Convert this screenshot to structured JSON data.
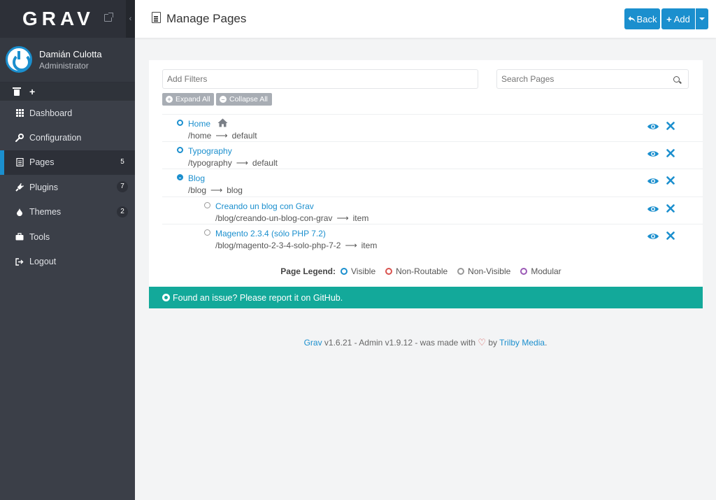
{
  "sidebar": {
    "logo": "GRAV",
    "collapse_glyph": "‹",
    "user": {
      "name": "Damián Culotta",
      "role": "Administrator"
    },
    "quick": {
      "trash": "trash-icon",
      "add": "+"
    },
    "items": [
      {
        "label": "Dashboard",
        "icon": "grid-icon",
        "badge": ""
      },
      {
        "label": "Configuration",
        "icon": "wrench-icon",
        "badge": ""
      },
      {
        "label": "Pages",
        "icon": "file-icon",
        "badge": "5"
      },
      {
        "label": "Plugins",
        "icon": "plug-icon",
        "badge": "7"
      },
      {
        "label": "Themes",
        "icon": "tint-icon",
        "badge": "2"
      },
      {
        "label": "Tools",
        "icon": "briefcase-icon",
        "badge": ""
      },
      {
        "label": "Logout",
        "icon": "sign-out-icon",
        "badge": ""
      }
    ]
  },
  "header": {
    "title": "Manage Pages",
    "back_label": "Back",
    "add_label": "Add"
  },
  "filters": {
    "filter_placeholder": "Add Filters",
    "search_placeholder": "Search Pages",
    "expand_label": "Expand All",
    "collapse_label": "Collapse All"
  },
  "pages": [
    {
      "title": "Home",
      "route": "/home",
      "template": "default",
      "level": 0,
      "state": "visible",
      "home": true
    },
    {
      "title": "Typography",
      "route": "/typography",
      "template": "default",
      "level": 0,
      "state": "visible",
      "home": false
    },
    {
      "title": "Blog",
      "route": "/blog",
      "template": "blog",
      "level": 0,
      "state": "expanded",
      "home": false
    },
    {
      "title": "Creando un blog con Grav",
      "route": "/blog/creando-un-blog-con-grav",
      "template": "item",
      "level": 1,
      "state": "non-visible",
      "home": false
    },
    {
      "title": "Magento 2.3.4 (sólo PHP 7.2)",
      "route": "/blog/magento-2-3-4-solo-php-7-2",
      "template": "item",
      "level": 1,
      "state": "non-visible",
      "home": false
    }
  ],
  "arrow": "⟶",
  "legend": {
    "title": "Page Legend:",
    "items": [
      {
        "label": "Visible",
        "color": "#1b8fce"
      },
      {
        "label": "Non-Routable",
        "color": "#d9534f"
      },
      {
        "label": "Non-Visible",
        "color": "#999999"
      },
      {
        "label": "Modular",
        "color": "#9b59b6"
      }
    ]
  },
  "notice": "Found an issue? Please report it on GitHub.",
  "footer": {
    "grav": "Grav",
    "version": " v1.6.21 - Admin v1.9.12 - was made with ",
    "heart": "♡",
    "by": " by ",
    "trilby": "Trilby Media",
    "dot": "."
  },
  "colors": {
    "accent": "#1b8fce",
    "notice": "#13a99a",
    "sidebar": "#3b3f48"
  }
}
